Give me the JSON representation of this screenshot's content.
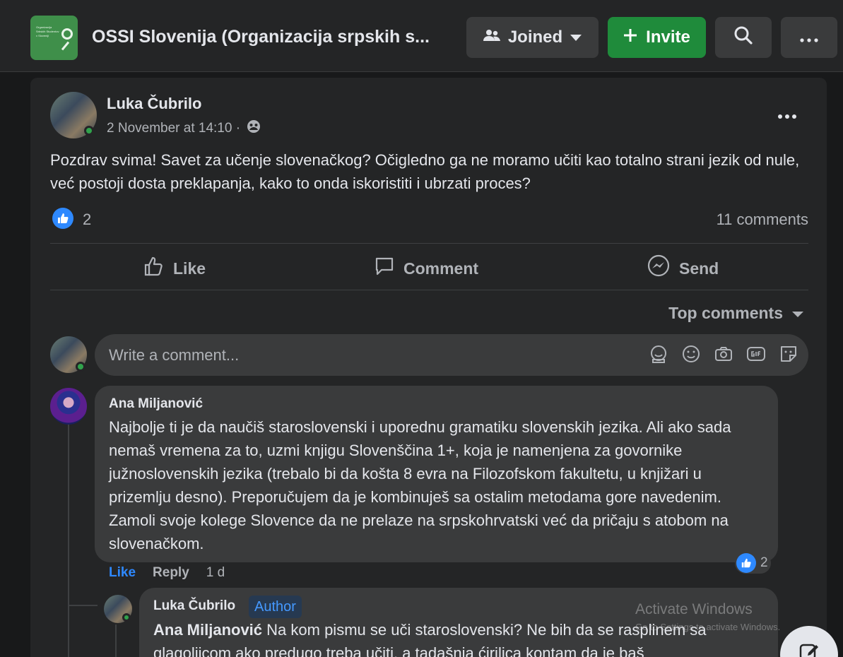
{
  "header": {
    "group_title": "OSSI Slovenija (Organizacija srpskih s...",
    "logo_text": "Organizacija Srbskih Studentov v Sloveniji",
    "joined_label": "Joined",
    "invite_label": "Invite"
  },
  "post": {
    "author": "Luka Čubrilo",
    "timestamp": "2 November at 14:10 ·",
    "text": "Pozdrav svima! Savet za učenje slovenačkog? Očigledno ga ne moramo učiti kao totalno strani jezik od nule, već postoji dosta preklapanja, kako to onda iskoristiti i ubrzati proces?",
    "reaction_count": "2",
    "comment_count": "11 comments"
  },
  "actions": {
    "like": "Like",
    "comment": "Comment",
    "send": "Send"
  },
  "comments_sort": "Top comments",
  "write_comment_placeholder": "Write a comment...",
  "comments": [
    {
      "author": "Ana Miljanović",
      "text": "Najbolje ti je da naučiš staroslovenski i uporednu gramatiku slovenskih jezika. Ali ako sada nemaš vremena za to, uzmi knjigu Slovenščina 1+, koja je namenjena za govornike južnoslovenskih jezika (trebalo bi da košta 8 evra na Filozofskom fakultetu, u knjižari u prizemlju desno). Preporučujem da je kombinuješ sa ostalim metodama gore navedenim. Zamoli svoje kolege Slovence da ne prelaze na srpskohrvatski već da pričaju s atobom na slovenačkom.",
      "like_label": "Like",
      "reply_label": "Reply",
      "age": "1 d",
      "reaction_count": "2"
    }
  ],
  "reply": {
    "author": "Luka Čubrilo",
    "badge": "Author",
    "mention": "Ana Miljanović",
    "text": " Na kom pismu se uči staroslovenski? Ne bih da se rasplinem sa glagoljicom ako predugo treba učiti, a tadašnja ćirilica kontam da je baš"
  },
  "watermark": {
    "title": "Activate Windows",
    "subtitle": "Go to Settings to activate Windows."
  },
  "colors": {
    "background": "#18191a",
    "card": "#242526",
    "bubble": "#3a3b3c",
    "accent_blue": "#2e89ff",
    "invite_green": "#1f8b3b",
    "online_green": "#31a24c"
  }
}
